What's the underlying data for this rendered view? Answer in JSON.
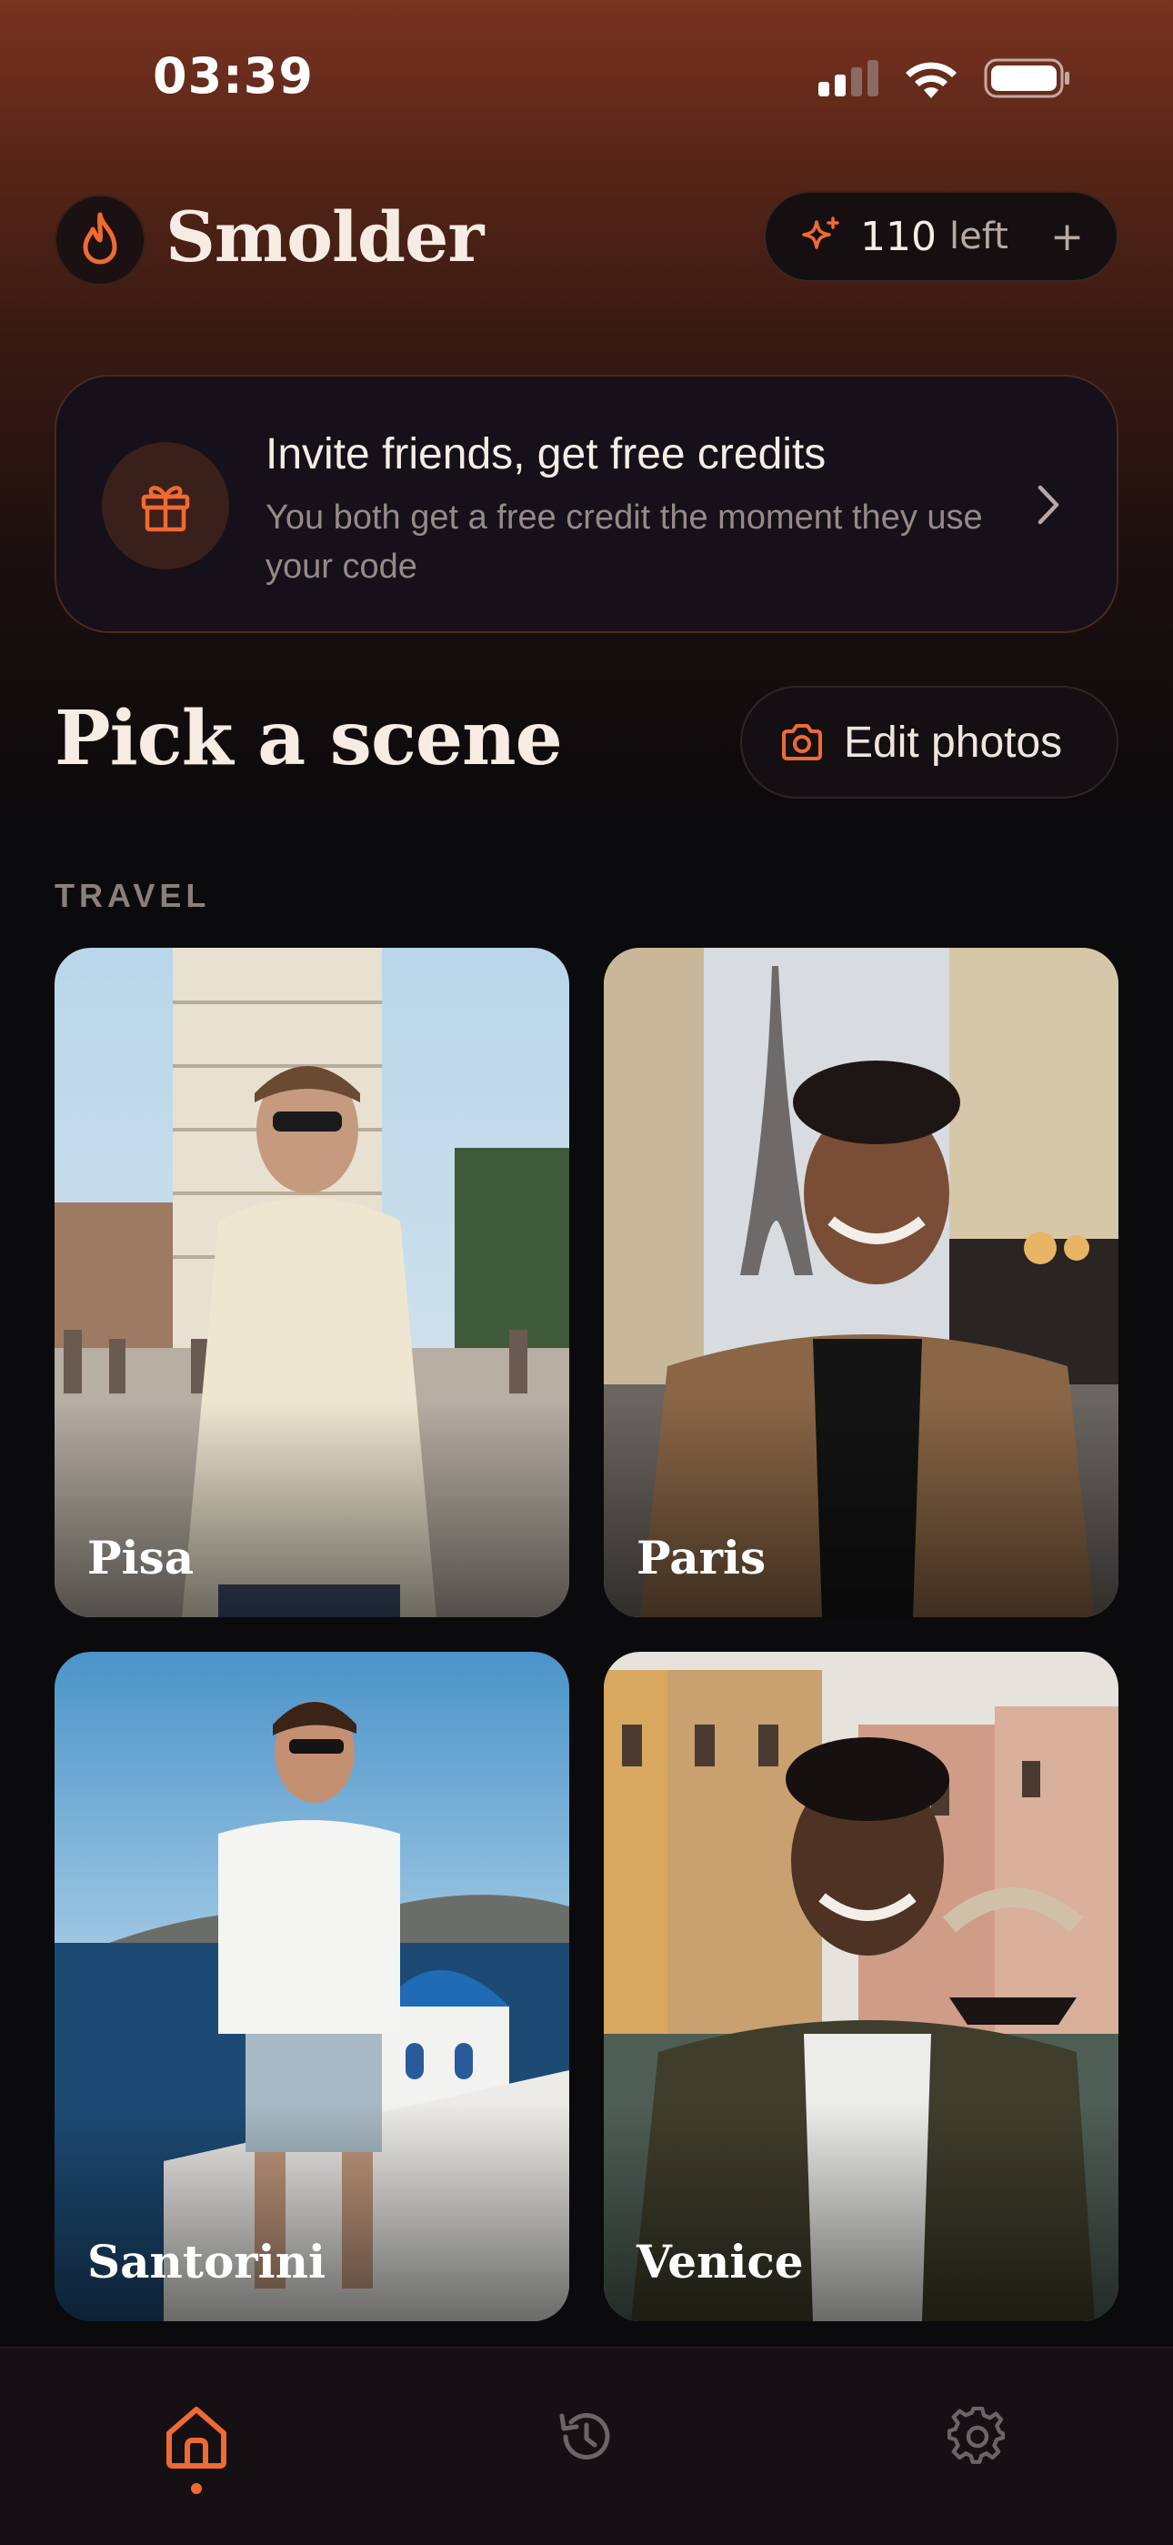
{
  "status_bar": {
    "time": "03:39"
  },
  "header": {
    "app_name": "Smolder",
    "credits": {
      "count": "110",
      "suffix": "left",
      "plus": "+"
    }
  },
  "invite": {
    "title": "Invite friends, get free credits",
    "subtitle": "You both get a free credit the moment they use your code"
  },
  "main": {
    "title": "Pick a scene",
    "edit_button": "Edit photos",
    "category": "TRAVEL",
    "scenes": [
      {
        "label": "Pisa"
      },
      {
        "label": "Paris"
      },
      {
        "label": "Santorini"
      },
      {
        "label": "Venice"
      }
    ]
  },
  "tabbar": {
    "tabs": [
      {
        "icon": "home-icon",
        "active": true
      },
      {
        "icon": "history-icon",
        "active": false
      },
      {
        "icon": "gear-icon",
        "active": false
      }
    ]
  },
  "colors": {
    "accent": "#f06a32",
    "background": "#0b0a0c",
    "header_top": "#7a3320"
  }
}
